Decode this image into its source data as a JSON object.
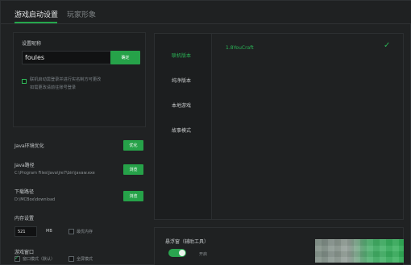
{
  "tabs": {
    "game_settings": "游戏启动设置",
    "player_appearance": "玩家形象"
  },
  "login_nickname": {
    "label": "设置昵称",
    "value": "foules",
    "button": "确定",
    "notice_line1": "联机启动需登录并进行实名制方可更改",
    "notice_line2": "如需更改请前往账号登录"
  },
  "settings": {
    "java_optimize_label": "Java环境优化",
    "java_optimize_button": "优化",
    "java_path_label": "Java路径",
    "java_path_value": "C:\\Program Files\\Java\\jre7\\bin\\javaw.exe",
    "browse_button": "浏览",
    "download_path_label": "下载路径",
    "download_path_value": "D:\\MCBox\\download",
    "browse_button2": "浏览",
    "memory_label": "内存设置",
    "memory_value": "521",
    "memory_unit": "MB",
    "max_memory_label": "最优内存",
    "window_label": "游戏窗口",
    "window_default": "窗口模式（默认）",
    "window_fullscreen": "全屏模式"
  },
  "version_menu": {
    "items": [
      "联机版本",
      "纯净版本",
      "本地游戏",
      "故事模式"
    ],
    "selected": "1.8YouCraft"
  },
  "plugin": {
    "label": "悬浮窗（辅助工具）",
    "state": "开启"
  },
  "colors": {
    "accent": "#2ab255",
    "background": "#1f2122",
    "panel": "#1d1f20"
  }
}
